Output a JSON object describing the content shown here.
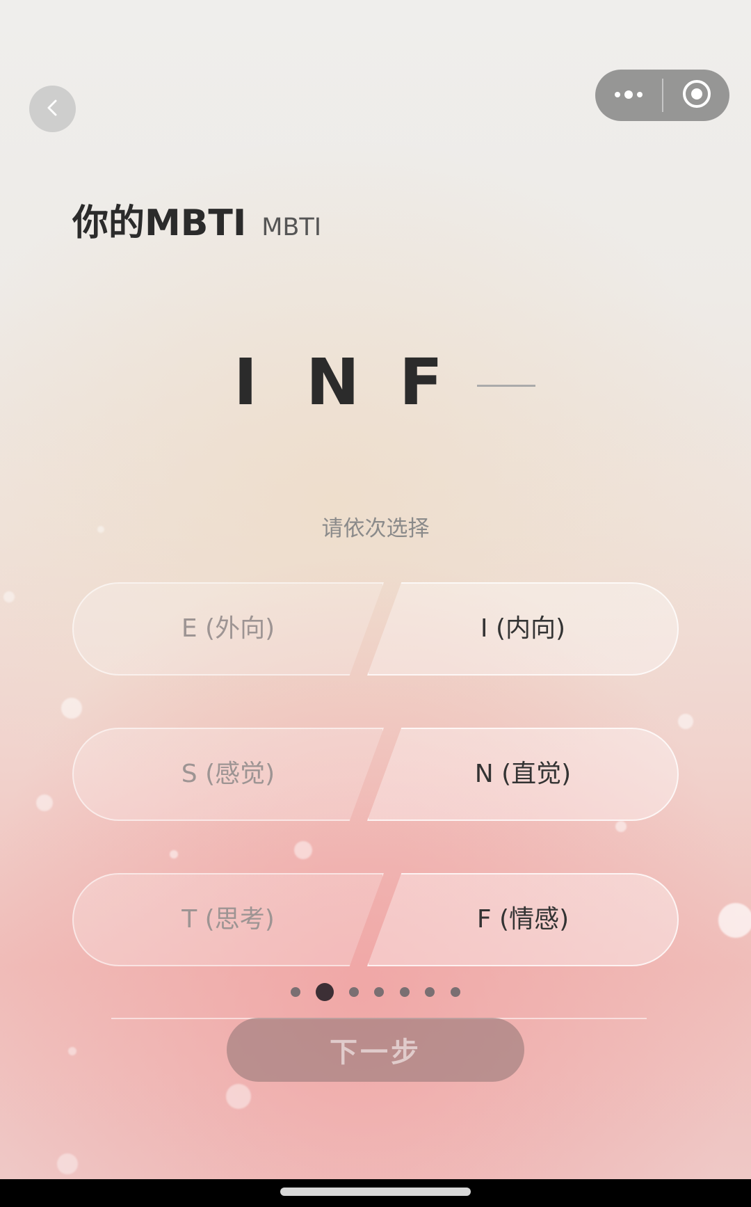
{
  "nav": {
    "back_icon": "chevron-left-icon",
    "menu_icon": "more-dots-icon",
    "close_icon": "target-circle-icon"
  },
  "header": {
    "title": "你的MBTI",
    "subtitle": "MBTI"
  },
  "result": {
    "letters": [
      "I",
      "N",
      "F"
    ],
    "pending_placeholder": "—"
  },
  "hint": "请依次选择",
  "options": [
    {
      "left": "E (外向)",
      "right": "I (内向)",
      "selected": "right"
    },
    {
      "left": "S (感觉)",
      "right": "N (直觉)",
      "selected": "right"
    },
    {
      "left": "T (思考)",
      "right": "F (情感)",
      "selected": "right"
    }
  ],
  "pager": {
    "total": 7,
    "current": 2
  },
  "next_button": "下一步",
  "colors": {
    "text_dark": "#2b2b2b",
    "text_muted": "#9d9493",
    "button_bg": "#967878",
    "active_dot": "#3c2f35"
  }
}
